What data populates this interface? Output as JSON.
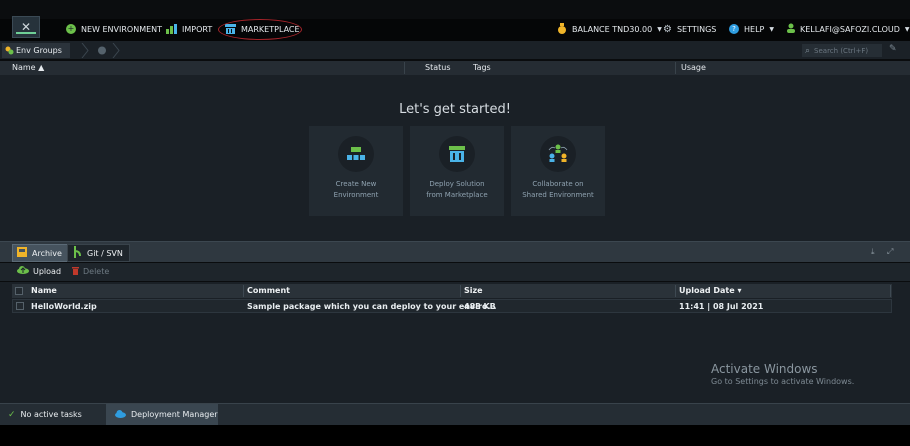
{
  "header": {
    "new_environment": "NEW ENVIRONMENT",
    "import": "IMPORT",
    "marketplace": "MARKETPLACE",
    "balance": "BALANCE TND30.00",
    "settings": "SETTINGS",
    "help": "HELP",
    "user": "KELLAFI@SAFOZI.CLOUD"
  },
  "env_bar": {
    "tab_label": "Env Groups",
    "search_placeholder": "Search (Ctrl+F)"
  },
  "env_columns": {
    "name": "Name ▲",
    "status": "Status",
    "tags": "Tags",
    "usage": "Usage"
  },
  "main": {
    "heading": "Let's get started!",
    "cards": [
      {
        "line1": "Create New",
        "line2": "Environment",
        "icon": "create-environment-icon"
      },
      {
        "line1": "Deploy Solution",
        "line2": "from Marketplace",
        "icon": "marketplace-icon"
      },
      {
        "line1": "Collaborate on",
        "line2": "Shared Environment",
        "icon": "collaborate-icon"
      }
    ]
  },
  "deployment": {
    "tabs": [
      {
        "label": "Archive",
        "icon": "archive-icon"
      },
      {
        "label": "Git / SVN",
        "icon": "git-icon"
      }
    ],
    "toolbar": {
      "upload": "Upload",
      "delete": "Delete"
    },
    "columns": {
      "name": "Name",
      "comment": "Comment",
      "size": "Size",
      "upload_date": "Upload Date ▾"
    },
    "rows": [
      {
        "name": "HelloWorld.zip",
        "comment": "Sample package which you can deploy to your enviro...",
        "size": "488 KB",
        "upload_date": "11:41 | 08 Jul 2021"
      }
    ]
  },
  "watermark": {
    "title": "Activate Windows",
    "subtitle": "Go to Settings to activate Windows."
  },
  "bottom": {
    "tasks": "No active tasks",
    "deployment_manager": "Deployment Manager"
  },
  "colors": {
    "accent_green": "#6cc04a",
    "marketplace_blue": "#4ab3e8",
    "highlight_red": "#a5242a",
    "balance_yellow": "#f0b429"
  }
}
